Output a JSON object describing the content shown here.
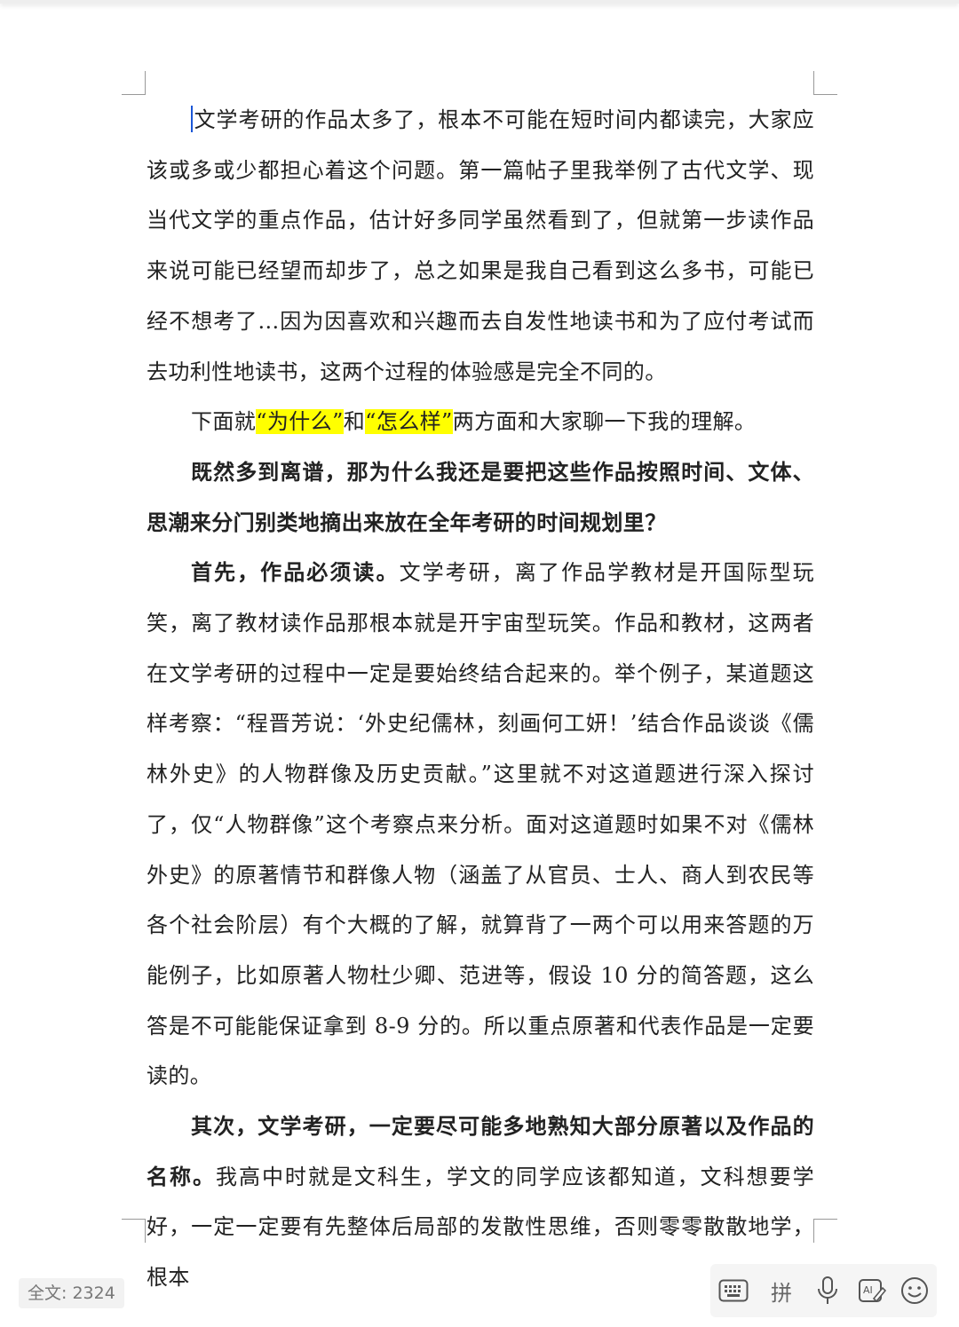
{
  "document": {
    "p1": "文学考研的作品太多了，根本不可能在短时间内都读完，大家应该或多或少都担心着这个问题。第一篇帖子里我举例了古代文学、现当代文学的重点作品，估计好多同学虽然看到了，但就第一步读作品来说可能已经望而却步了，总之如果是我自己看到这么多书，可能已经不想考了...因为因喜欢和兴趣而去自发性地读书和为了应付考试而去功利性地读书，这两个过程的体验感是完全不同的。",
    "p2": {
      "a": "下面就",
      "hl1": "“为什么”",
      "b": "和",
      "hl2": "“怎么样”",
      "c": "两方面和大家聊一下我的理解。"
    },
    "p3": "既然多到离谱，那为什么我还是要把这些作品按照时间、文体、思潮来分门别类地摘出来放在全年考研的时间规划里？",
    "p4": {
      "bold": "首先，作品必须读。",
      "text": "文学考研，离了作品学教材是开国际型玩笑，离了教材读作品那根本就是开宇宙型玩笑。作品和教材，这两者在文学考研的过程中一定是要始终结合起来的。举个例子，某道题这样考察：“程晋芳说：‘外史纪儒林，刻画何工妍！’结合作品谈谈《儒林外史》的人物群像及历史贡献。”这里就不对这道题进行深入探讨了，仅“人物群像”这个考察点来分析。面对这道题时如果不对《儒林外史》的原著情节和群像人物（涵盖了从官员、士人、商人到农民等各个社会阶层）有个大概的了解，就算背了一两个可以用来答题的万能例子，比如原著人物杜少卿、范进等，假设 10 分的简答题，这么答是不可能能保证拿到 8-9 分的。所以重点原著和代表作品是一定要读的。"
    },
    "p5": {
      "bold": "其次，文学考研，一定要尽可能多地熟知大部分原著以及作品的名称。",
      "text": "我高中时就是文科生，学文的同学应该都知道，文科想要学好，一定一定要有先整体后局部的发散性思维，否则零零散散地学，根本"
    }
  },
  "status": {
    "word_count": "全文: 2324"
  },
  "keyboard_toolbar": {
    "pinyin_label": "拼",
    "icons": [
      "keyboard-icon",
      "pinyin-icon",
      "microphone-icon",
      "ai-write-icon",
      "emoji-icon"
    ]
  },
  "colors": {
    "highlight": "#ffff00",
    "cursor": "#1a56d6"
  }
}
